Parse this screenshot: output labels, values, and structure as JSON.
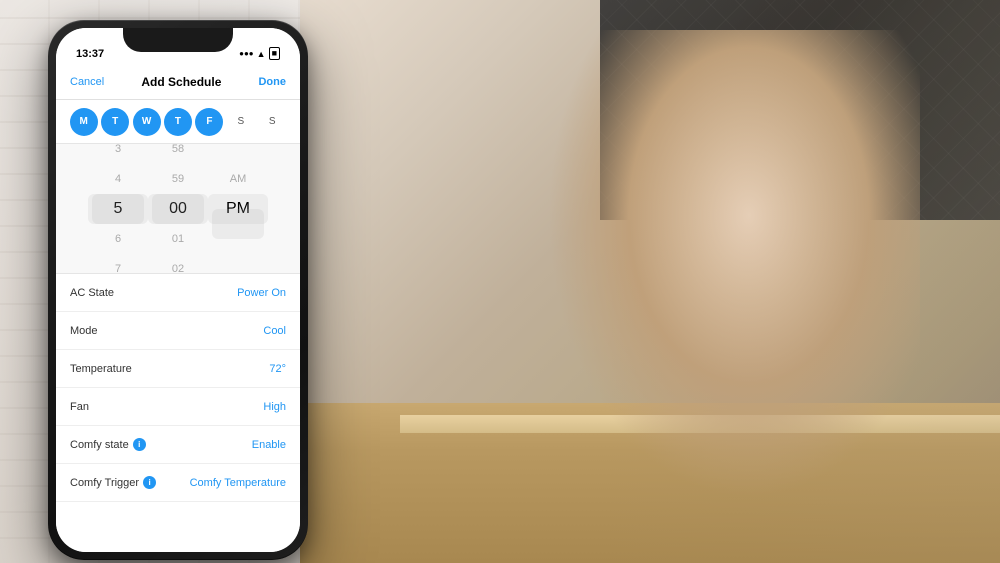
{
  "background": {
    "wall_color": "#ede8e2",
    "kitchen_color": "#c8b898"
  },
  "phone": {
    "status_bar": {
      "time": "13:37",
      "signal": "●●●",
      "wifi": "wifi",
      "battery": "🔋"
    },
    "nav": {
      "cancel": "Cancel",
      "title": "Add Schedule",
      "done": "Done"
    },
    "days": [
      {
        "label": "M",
        "active": true
      },
      {
        "label": "T",
        "active": true
      },
      {
        "label": "W",
        "active": true
      },
      {
        "label": "T",
        "active": true
      },
      {
        "label": "F",
        "active": true
      },
      {
        "label": "S",
        "active": false
      },
      {
        "label": "S",
        "active": false
      }
    ],
    "time_picker": {
      "hours": [
        "3",
        "4",
        "5",
        "6",
        "7"
      ],
      "minutes": [
        "58",
        "59",
        "00",
        "01",
        "02"
      ],
      "period": [
        "AM",
        "PM"
      ],
      "selected_hour": "5",
      "selected_minute": "00",
      "selected_period": "PM"
    },
    "settings": [
      {
        "label": "AC State",
        "value": "Power On",
        "has_info": false
      },
      {
        "label": "Mode",
        "value": "Cool",
        "has_info": false
      },
      {
        "label": "Temperature",
        "value": "72°",
        "has_info": false
      },
      {
        "label": "Fan",
        "value": "High",
        "has_info": false
      },
      {
        "label": "Comfy state",
        "value": "Enable",
        "has_info": true
      },
      {
        "label": "Comfy Trigger",
        "value": "Comfy Temperature",
        "has_info": true
      }
    ]
  }
}
